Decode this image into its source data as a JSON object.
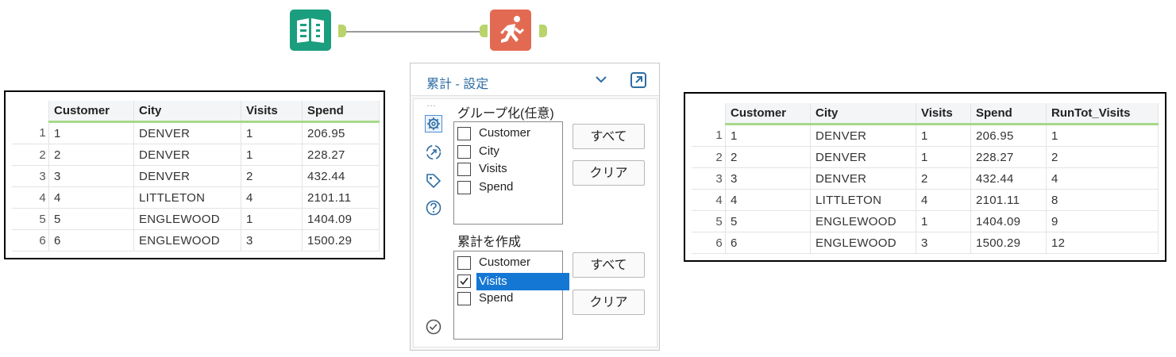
{
  "workflow": {
    "input_tool_icon": "book-icon",
    "running_tool_icon": "running-person-icon",
    "input_color": "#1b9e7e",
    "running_color": "#e36a52"
  },
  "input_table": {
    "columns": [
      "Customer",
      "City",
      "Visits",
      "Spend"
    ],
    "rows": [
      {
        "n": "1",
        "cells": [
          "1",
          "DENVER",
          "1",
          "206.95"
        ]
      },
      {
        "n": "2",
        "cells": [
          "2",
          "DENVER",
          "1",
          "228.27"
        ]
      },
      {
        "n": "3",
        "cells": [
          "3",
          "DENVER",
          "2",
          "432.44"
        ]
      },
      {
        "n": "4",
        "cells": [
          "4",
          "LITTLETON",
          "4",
          "2101.11"
        ]
      },
      {
        "n": "5",
        "cells": [
          "5",
          "ENGLEWOOD",
          "1",
          "1404.09"
        ]
      },
      {
        "n": "6",
        "cells": [
          "6",
          "ENGLEWOOD",
          "3",
          "1500.29"
        ]
      }
    ]
  },
  "panel": {
    "title": "累計 - 設定",
    "group_section": "グループ化(任意)",
    "group_fields": [
      {
        "label": "Customer",
        "checked": false,
        "selected": false
      },
      {
        "label": "City",
        "checked": false,
        "selected": false
      },
      {
        "label": "Visits",
        "checked": false,
        "selected": false
      },
      {
        "label": "Spend",
        "checked": false,
        "selected": false
      }
    ],
    "running_section": "累計を作成",
    "running_fields": [
      {
        "label": "Customer",
        "checked": false,
        "selected": false
      },
      {
        "label": "Visits",
        "checked": true,
        "selected": true
      },
      {
        "label": "Spend",
        "checked": false,
        "selected": false
      }
    ],
    "all_button": "すべて",
    "clear_button": "クリア",
    "dots": "…",
    "accent_color": "#2e6da4"
  },
  "output_table": {
    "columns": [
      "Customer",
      "City",
      "Visits",
      "Spend",
      "RunTot_Visits"
    ],
    "rows": [
      {
        "n": "1",
        "cells": [
          "1",
          "DENVER",
          "1",
          "206.95",
          "1"
        ]
      },
      {
        "n": "2",
        "cells": [
          "2",
          "DENVER",
          "1",
          "228.27",
          "2"
        ]
      },
      {
        "n": "3",
        "cells": [
          "3",
          "DENVER",
          "2",
          "432.44",
          "4"
        ]
      },
      {
        "n": "4",
        "cells": [
          "4",
          "LITTLETON",
          "4",
          "2101.11",
          "8"
        ]
      },
      {
        "n": "5",
        "cells": [
          "5",
          "ENGLEWOOD",
          "1",
          "1404.09",
          "9"
        ]
      },
      {
        "n": "6",
        "cells": [
          "6",
          "ENGLEWOOD",
          "3",
          "1500.29",
          "12"
        ]
      }
    ]
  }
}
